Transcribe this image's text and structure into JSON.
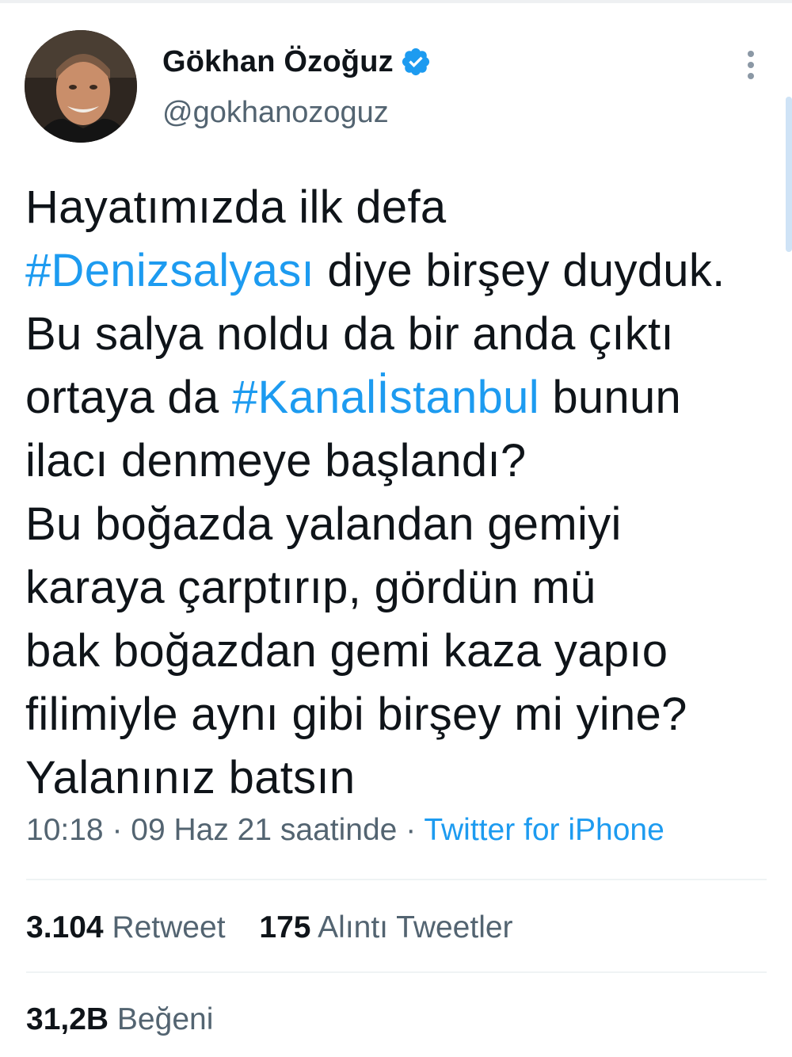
{
  "author": {
    "name": "Gökhan Özoğuz",
    "handle": "@gokhanozoguz",
    "verified": true,
    "icons": {
      "verified": "verified-badge-icon",
      "more": "more-vertical-icon"
    }
  },
  "tweet": {
    "lines": [
      [
        {
          "t": "Hayatımızda ilk defa"
        }
      ],
      [
        {
          "t": "#Denizsalyası",
          "h": true
        },
        {
          "t": " diye birşey duyduk."
        }
      ],
      [
        {
          "t": "Bu salya noldu da bir anda çıktı"
        }
      ],
      [
        {
          "t": "ortaya da "
        },
        {
          "t": "#Kanalİstanbul",
          "h": true
        },
        {
          "t": " bunun"
        }
      ],
      [
        {
          "t": "ilacı denmeye başlandı?"
        }
      ],
      [
        {
          "t": "Bu boğazda yalandan gemiyi"
        }
      ],
      [
        {
          "t": "karaya çarptırıp, gördün mü"
        }
      ],
      [
        {
          "t": "bak boğazdan gemi kaza yapıo"
        }
      ],
      [
        {
          "t": "filimiyle aynı gibi birşey mi yine?"
        }
      ],
      [
        {
          "t": "Yalanınız batsın"
        }
      ]
    ],
    "hashtag_color": "#1d9bf0"
  },
  "meta": {
    "time": "10:18",
    "sep1": " · ",
    "date": "09 Haz 21 saatinde",
    "sep2": " · ",
    "source": "Twitter for iPhone"
  },
  "stats": {
    "retweets_count": "3.104",
    "retweets_label": "Retweet",
    "quotes_count": "175",
    "quotes_label": "Alıntı Tweetler",
    "likes_count": "31,2B",
    "likes_label": "Beğeni"
  }
}
